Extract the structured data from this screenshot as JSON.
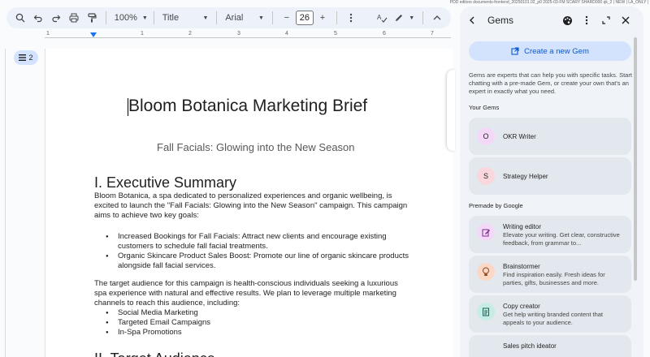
{
  "toolbar": {
    "zoom": "100%",
    "style": "Title",
    "font": "Arial",
    "font_size": "26",
    "minus": "−",
    "plus": "+"
  },
  "ruler": {
    "numbers": [
      "1",
      "1",
      "2",
      "3",
      "4",
      "5",
      "6",
      "7"
    ]
  },
  "outline": {
    "count": "2"
  },
  "document": {
    "title": "Bloom Botanica Marketing Brief",
    "subtitle": "Fall Facials: Glowing into the New Season",
    "heading1": "I. Executive Summary",
    "para1": "Bloom Botanica, a spa dedicated to personalized experiences and organic wellbeing, is excited to launch the \"Fall Facials: Glowing into the New Season\" campaign. This campaign aims to achieve two key goals:",
    "goals": [
      "Increased Bookings for Fall Facials: Attract new clients and encourage existing customers to schedule fall facial treatments.",
      "Organic Skincare Product Sales Boost:  Promote our line of organic skincare products alongside fall facial services."
    ],
    "para2": "The target audience for this campaign is health-conscious individuals seeking a luxurious spa experience with natural and effective results. We plan to leverage multiple marketing channels to reach this audience, including:",
    "channels": [
      "Social Media Marketing",
      "Targeted Email Campaigns",
      "In-Spa Promotions"
    ],
    "heading2": "II. Target Audience"
  },
  "path_label": "PDD editors documents-frontend_20250101.02_p0 2025-03-FM SCARY SHARD000 qk_2 | NEW | LA_ONLY |",
  "panel": {
    "title": "Gems",
    "create_label": "Create a new Gem",
    "description": "Gems are experts that can help you with specific tasks. Start chatting with a pre-made Gem, or create your own that's an expert in exactly what you need.",
    "your_gems_label": "Your Gems",
    "your_gems": [
      {
        "initial": "O",
        "name": "OKR Writer",
        "color": "#f3d9f7"
      },
      {
        "initial": "S",
        "name": "Strategy Helper",
        "color": "#f9d7dc"
      }
    ],
    "premade_label": "Premade by Google",
    "premade": [
      {
        "title": "Writing editor",
        "desc": "Elevate your writing. Get clear, constructive feedback, from grammar to...",
        "icon": "edit-icon",
        "color": "#f3d9f7"
      },
      {
        "title": "Brainstormer",
        "desc": "Find inspiration easily. Fresh ideas for parties, gifts, businesses and more.",
        "icon": "lightbulb-icon",
        "color": "#fbd8c6"
      },
      {
        "title": "Copy creator",
        "desc": "Get help writing branded content that appeals to your audience.",
        "icon": "document-icon",
        "color": "#c7ebe5"
      },
      {
        "title": "Sales pitch ideator",
        "desc": "",
        "icon": "pitch-icon",
        "color": "#d3e3fd"
      }
    ]
  },
  "colors": {
    "accent": "#0b57d0",
    "panel_bg": "#f0f4f9",
    "card_bg": "#e3e8ee",
    "create_bg": "#d3e3fd"
  }
}
